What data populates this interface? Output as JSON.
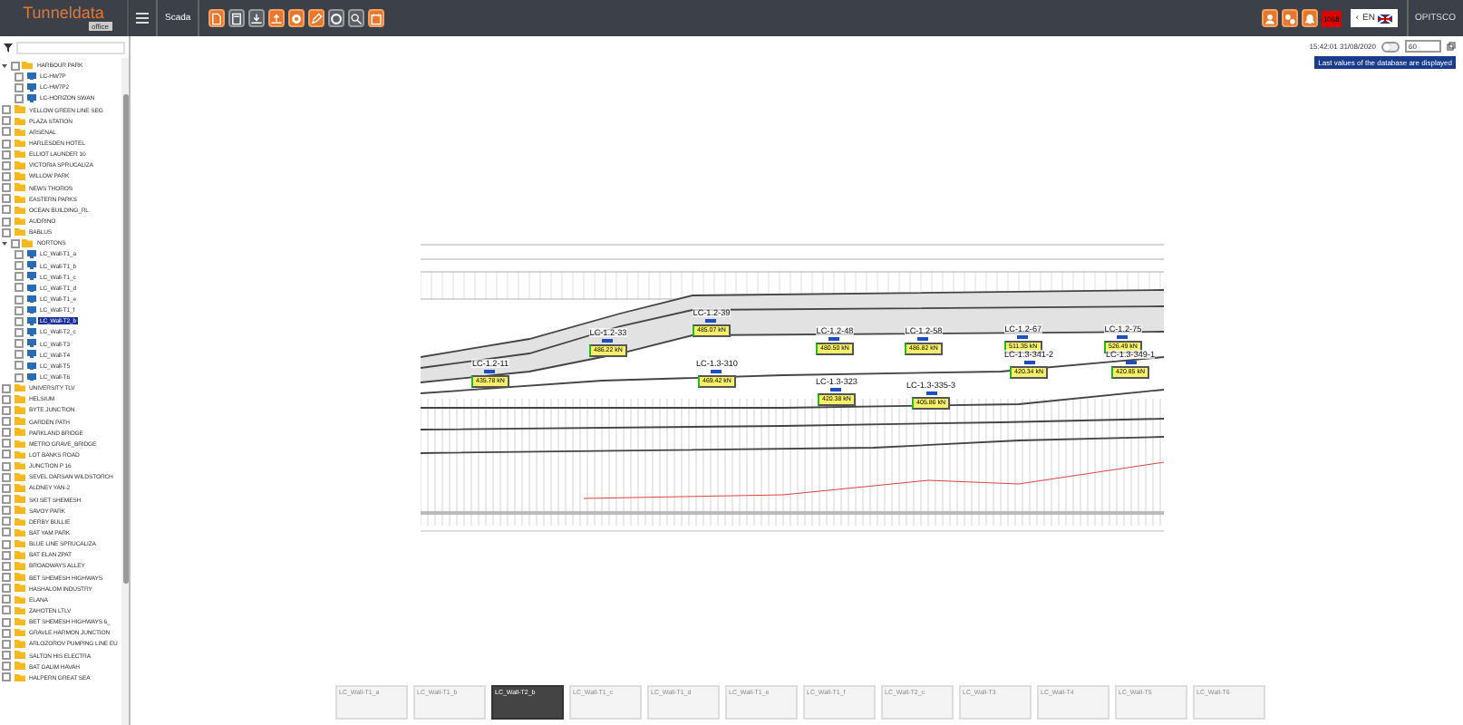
{
  "header": {
    "logo": "Tunneldata",
    "logo_sub": "office",
    "module": "Scada",
    "tools": [
      {
        "kind": "pdf",
        "highlighted": true
      },
      {
        "kind": "save",
        "highlighted": false
      },
      {
        "kind": "download",
        "highlighted": false
      },
      {
        "kind": "upload",
        "highlighted": true
      },
      {
        "kind": "record",
        "highlighted": true
      },
      {
        "kind": "edit",
        "highlighted": true
      },
      {
        "kind": "gear",
        "highlighted": false
      },
      {
        "kind": "search",
        "highlighted": false
      },
      {
        "kind": "calendar",
        "highlighted": true
      }
    ],
    "alarm_count": "1068",
    "language_prev": "‹",
    "language": "EN",
    "brand": "OPITSCO"
  },
  "sidebar": {
    "tree": [
      {
        "label": "HARBOUR PARK",
        "expanded": true,
        "checked": false,
        "selected": false,
        "children": [
          {
            "label": "LC-HW7P",
            "checked": false,
            "selected": false
          },
          {
            "label": "LC-HW7P2",
            "checked": false,
            "selected": false
          },
          {
            "label": "LC-HORIZON SWAN",
            "checked": false,
            "selected": false
          }
        ]
      },
      {
        "label": "YELLOW GREEN LINE SEG",
        "checked": false,
        "selected": false
      },
      {
        "label": "PLAZA STATION",
        "checked": false,
        "selected": false
      },
      {
        "label": "ARSENAL",
        "checked": false,
        "selected": false
      },
      {
        "label": "HARLESDEN HOTEL",
        "checked": false,
        "selected": false
      },
      {
        "label": "ELLIOT LAUNDER 10",
        "checked": false,
        "selected": false
      },
      {
        "label": "VICTORIA SPRUCALIZA",
        "checked": false,
        "selected": false
      },
      {
        "label": "WILLOW PARK",
        "checked": false,
        "selected": false
      },
      {
        "label": "NEWS THOROS",
        "checked": false,
        "selected": false
      },
      {
        "label": "EASTERN PARKS",
        "checked": false,
        "selected": false
      },
      {
        "label": "OCEAN BUILDING_RL",
        "checked": false,
        "selected": false
      },
      {
        "label": "AUDRINO",
        "checked": false,
        "selected": false
      },
      {
        "label": "BABLUS",
        "checked": false,
        "selected": false
      },
      {
        "label": "NORTONS",
        "expanded": true,
        "checked": false,
        "selected": false,
        "children": [
          {
            "label": "LC_Wall-T1_a",
            "checked": false,
            "selected": false
          },
          {
            "label": "LC_Wall-T1_b",
            "checked": false,
            "selected": false
          },
          {
            "label": "LC_Wall-T1_c",
            "checked": false,
            "selected": false
          },
          {
            "label": "LC_Wall-T1_d",
            "checked": false,
            "selected": false
          },
          {
            "label": "LC_Wall-T1_e",
            "checked": false,
            "selected": false
          },
          {
            "label": "LC_Wall-T1_f",
            "checked": false,
            "selected": false
          },
          {
            "label": "LC_Wall-T2_b",
            "checked": false,
            "selected": true
          },
          {
            "label": "LC_Wall-T2_c",
            "checked": false,
            "selected": false
          },
          {
            "label": "LC_Wall-T3",
            "checked": false,
            "selected": false
          },
          {
            "label": "LC_Wall-T4",
            "checked": false,
            "selected": false
          },
          {
            "label": "LC_Wall-T5",
            "checked": false,
            "selected": false
          },
          {
            "label": "LC_Wall-T6",
            "checked": false,
            "selected": false
          }
        ]
      },
      {
        "label": "UNIVERSITY TLV",
        "checked": false,
        "selected": false
      },
      {
        "label": "HELSIUM",
        "checked": false,
        "selected": false
      },
      {
        "label": "BYTE JUNCTION",
        "checked": false,
        "selected": false
      },
      {
        "label": "GARDEN PATH",
        "checked": false,
        "selected": false
      },
      {
        "label": "PARKLAND BRIDGE",
        "checked": false,
        "selected": false
      },
      {
        "label": "METRO GRAVE_BRIDGE",
        "checked": false,
        "selected": false
      },
      {
        "label": "LOT BANKS ROAD",
        "checked": false,
        "selected": false
      },
      {
        "label": "JUNCTION P 16",
        "checked": false,
        "selected": false
      },
      {
        "label": "SEVEL DARSAN WILDSTORCH",
        "checked": false,
        "selected": false
      },
      {
        "label": "ALDNEY YAN-2",
        "checked": false,
        "selected": false
      },
      {
        "label": "SKI SET SHEMESH",
        "checked": false,
        "selected": false
      },
      {
        "label": "SAVOY PARK",
        "checked": false,
        "selected": false
      },
      {
        "label": "DERBY BULLIE",
        "checked": false,
        "selected": false
      },
      {
        "label": "BAT YAM PARK",
        "checked": false,
        "selected": false
      },
      {
        "label": "BLUE LINE SPRUCALIZA",
        "checked": false,
        "selected": false
      },
      {
        "label": "BAT ELAN ZPAT",
        "checked": false,
        "selected": false
      },
      {
        "label": "BROADWAYS ALLEY",
        "checked": false,
        "selected": false
      },
      {
        "label": "BET SHEMESH HIGHWAYS",
        "checked": false,
        "selected": false
      },
      {
        "label": "HASHALOM INDUSTRY",
        "checked": false,
        "selected": false
      },
      {
        "label": "ELANA",
        "checked": false,
        "selected": false
      },
      {
        "label": "ZAHOTEN LTLV",
        "checked": false,
        "selected": false
      },
      {
        "label": "BET SHEMESH HIGHWAYS 6_",
        "checked": false,
        "selected": false
      },
      {
        "label": "GRAVLE HARMON JUNCTION",
        "checked": false,
        "selected": false
      },
      {
        "label": "ARLOZOROV PUMPING LINE EU",
        "checked": false,
        "selected": false
      },
      {
        "label": "SALTON HIS ELECTRA",
        "checked": false,
        "selected": false
      },
      {
        "label": "BAT GALIM HAVAH",
        "checked": false,
        "selected": false
      },
      {
        "label": "HALPERN GREAT SEA",
        "checked": false,
        "selected": false
      }
    ]
  },
  "status": {
    "timestamp": "15:42:01 31/08/2020",
    "live": false,
    "refresh": "60",
    "notice": "Last values of the database are displayed"
  },
  "gauges": [
    {
      "name": "LC-1.2-33",
      "value": "486.22 kN"
    },
    {
      "name": "LC-1.2-39",
      "value": "485.07 kN"
    },
    {
      "name": "LC-1.2-48",
      "value": "480.50 kN"
    },
    {
      "name": "LC-1.2-58",
      "value": "486.82 kN"
    },
    {
      "name": "LC-1.2-67",
      "value": "511.35 kN"
    },
    {
      "name": "LC-1.2-75",
      "value": "526.49 kN"
    },
    {
      "name": "LC-1.2-11",
      "value": "435.78 kN"
    },
    {
      "name": "LC-1.3-310",
      "value": "469.42 kN"
    },
    {
      "name": "LC-1.3-323",
      "value": "420.38 kN"
    },
    {
      "name": "LC-1.3-335-3",
      "value": "405.86 kN"
    },
    {
      "name": "LC-1.3-341-2",
      "value": "420.34 kN"
    },
    {
      "name": "LC-1.3-349-1",
      "value": "420.85 kN"
    }
  ],
  "thumbnails": [
    {
      "label": "LC_Wall-T1_a",
      "selected": false
    },
    {
      "label": "LC_Wall-T1_b",
      "selected": false
    },
    {
      "label": "LC_Wall-T2_b",
      "selected": true
    },
    {
      "label": "LC_Wall-T1_c",
      "selected": false
    },
    {
      "label": "LC_Wall-T1_d",
      "selected": false
    },
    {
      "label": "LC_Wall-T1_e",
      "selected": false
    },
    {
      "label": "LC_Wall-T1_f",
      "selected": false
    },
    {
      "label": "LC_Wall-T2_c",
      "selected": false
    },
    {
      "label": "LC_Wall-T3",
      "selected": false
    },
    {
      "label": "LC_Wall-T4",
      "selected": false
    },
    {
      "label": "LC_Wall-T5",
      "selected": false
    },
    {
      "label": "LC_Wall-T6",
      "selected": false
    }
  ]
}
